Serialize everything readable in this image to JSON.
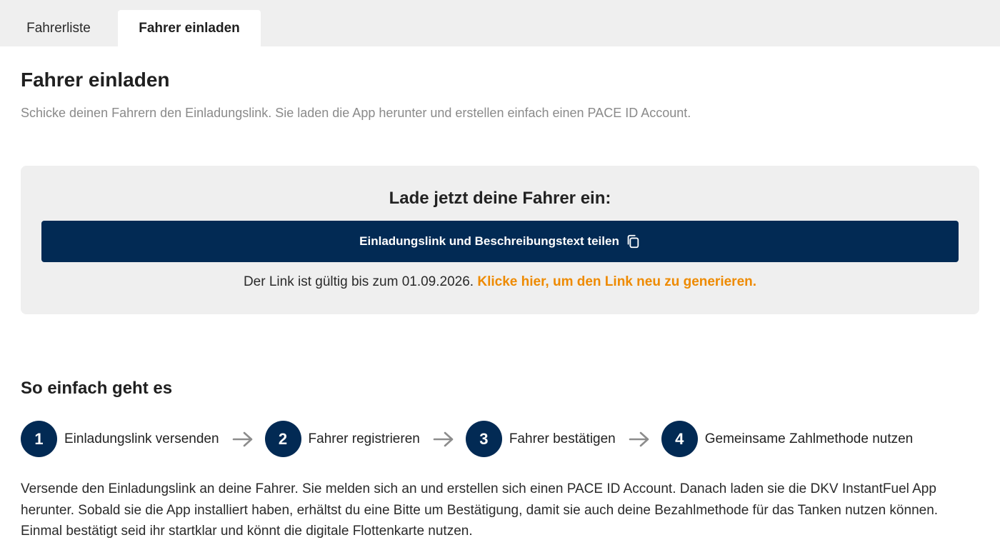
{
  "tabs": [
    {
      "label": "Fahrerliste",
      "active": false
    },
    {
      "label": "Fahrer einladen",
      "active": true
    }
  ],
  "page": {
    "title": "Fahrer einladen",
    "subtitle": "Schicke deinen Fahrern den Einladungslink. Sie laden die App herunter und erstellen einfach einen PACE ID Account."
  },
  "invite": {
    "heading": "Lade jetzt deine Fahrer ein:",
    "share_button_label": "Einladungslink und Beschreibungstext teilen",
    "share_icon": "copy-icon",
    "validity_text": "Der Link ist gültig bis zum 01.09.2026.",
    "regenerate_link": "Klicke hier, um den Link neu zu generieren."
  },
  "how_it_works": {
    "heading": "So einfach geht es",
    "steps": [
      {
        "number": "1",
        "label": "Einladungslink versenden"
      },
      {
        "number": "2",
        "label": "Fahrer registrieren"
      },
      {
        "number": "3",
        "label": "Fahrer bestätigen"
      },
      {
        "number": "4",
        "label": "Gemeinsame Zahlmethode nutzen"
      }
    ],
    "separator_icon": "arrow-right-icon",
    "description": "Versende den Einladungslink an deine Fahrer. Sie melden sich an und erstellen sich einen PACE ID Account. Danach laden sie die DKV InstantFuel App herunter. Sobald sie die App installiert haben, erhältst du eine Bitte um Bestätigung, damit sie auch deine Bezahlmethode für das Tanken nutzen können. Einmal bestätigt seid ihr startklar und könnt die digitale Flottenkarte nutzen."
  },
  "colors": {
    "primary": "#022a54",
    "accent": "#ee8a00",
    "box_background": "#efefef",
    "muted_text": "#8a8a8a"
  }
}
